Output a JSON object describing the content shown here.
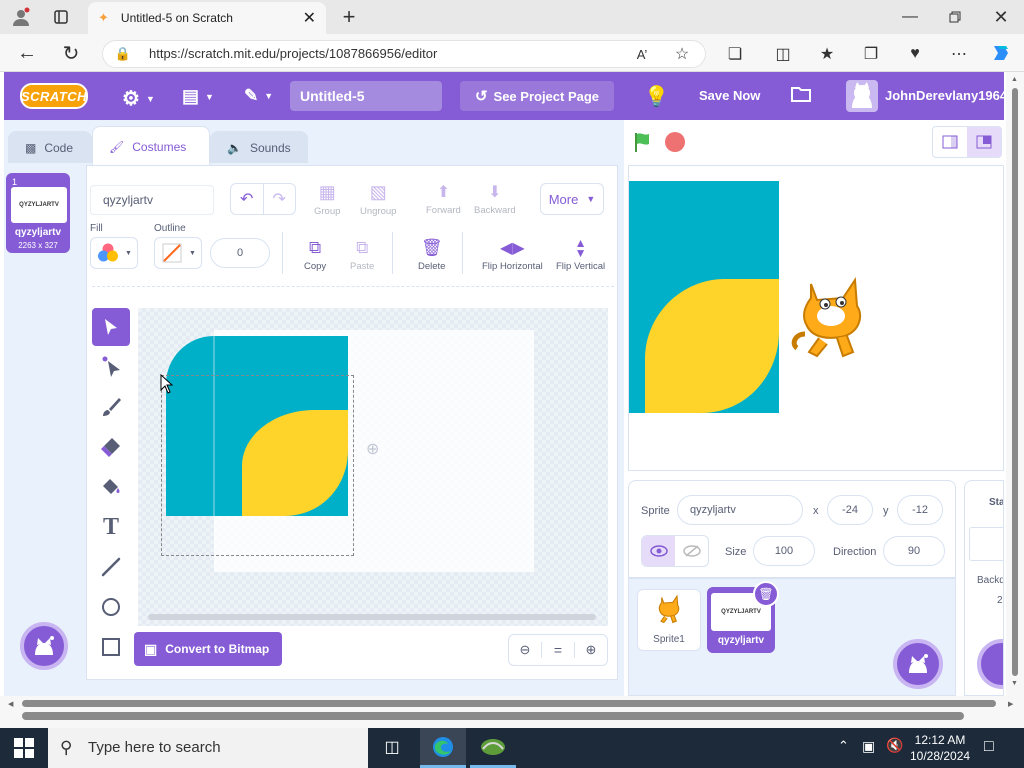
{
  "browser": {
    "tab_title": "Untitled-5 on Scratch",
    "url": "https://scratch.mit.edu/projects/1087866956/editor"
  },
  "menubar": {
    "logo": "SCRATCH",
    "project_title": "Untitled-5",
    "see_project_page": "See Project Page",
    "save_now": "Save Now",
    "username": "JohnDerevlany1964"
  },
  "editor_tabs": {
    "code": "Code",
    "costumes": "Costumes",
    "sounds": "Sounds"
  },
  "costume_list": [
    {
      "number": "1",
      "thumb_text": "QYZYLJARTV",
      "name": "qyzyljartv",
      "size": "2263 x 327"
    }
  ],
  "paint": {
    "costume_name": "qyzyljartv",
    "group": "Group",
    "ungroup": "Ungroup",
    "forward": "Forward",
    "backward": "Backward",
    "more": "More",
    "fill_label": "Fill",
    "outline_label": "Outline",
    "outline_width": "0",
    "copy": "Copy",
    "paste": "Paste",
    "delete": "Delete",
    "flip_horizontal": "Flip Horizontal",
    "flip_vertical": "Flip Vertical",
    "convert_to_bitmap": "Convert to Bitmap",
    "zoom_reset": "="
  },
  "sprite_info": {
    "sprite_label": "Sprite",
    "sprite_name": "qyzyljartv",
    "x_label": "x",
    "x": "-24",
    "y_label": "y",
    "y": "-12",
    "show_label": "Show",
    "size_label": "Size",
    "size": "100",
    "direction_label": "Direction",
    "direction": "90"
  },
  "sprites": [
    {
      "name": "Sprite1",
      "selected": false
    },
    {
      "name": "qyzyljartv",
      "thumb_text": "QYZYLJARTV",
      "selected": true
    }
  ],
  "stage_panel": {
    "stage_label": "Stag",
    "backdrops_label": "Backd",
    "backdrops_count": "2"
  },
  "taskbar": {
    "search_placeholder": "Type here to search",
    "time": "12:12 AM",
    "date": "10/28/2024"
  },
  "colors": {
    "scratch_purple": "#855cd6",
    "teal": "#00b0c8",
    "yellow": "#ffd42a",
    "green_flag": "#4cbf56",
    "stop": "#ec5959"
  }
}
